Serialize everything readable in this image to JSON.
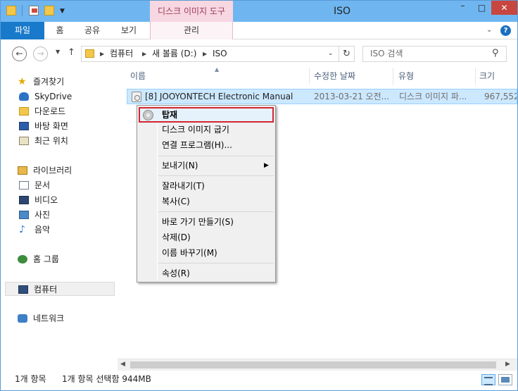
{
  "window": {
    "title": "ISO",
    "context_tab_title": "디스크 이미지 도구",
    "buttons": {
      "minimize": "–",
      "maximize": "□",
      "close": "✕"
    }
  },
  "ribbon": {
    "file_tab": "파일",
    "tabs": [
      "홈",
      "공유",
      "보기"
    ],
    "context_tab": "관리",
    "help": "?"
  },
  "address_bar": {
    "segments": [
      "컴퓨터",
      "새 볼륨 (D:)",
      "ISO"
    ],
    "search_placeholder": "ISO 검색"
  },
  "nav_pane": {
    "favorites": {
      "label": "즐겨찾기",
      "items": [
        "SkyDrive",
        "다운로드",
        "바탕 화면",
        "최근 위치"
      ]
    },
    "libraries": {
      "label": "라이브러리",
      "items": [
        "문서",
        "비디오",
        "사진",
        "음악"
      ]
    },
    "homegroup": "홈 그룹",
    "computer": "컴퓨터",
    "network": "네트워크"
  },
  "columns": {
    "name": "이름",
    "date": "수정한 날짜",
    "type": "유형",
    "size": "크기"
  },
  "files": [
    {
      "name": "[8] JOOYONTECH Electronic Manual",
      "date": "2013-03-21 오전...",
      "type": "디스크 이미지 파...",
      "size": "967,552"
    }
  ],
  "context_menu": {
    "highlighted": "탑재",
    "groups": [
      [
        "디스크 이미지 굽기",
        "연결 프로그램(H)..."
      ],
      [
        "보내기(N)"
      ],
      [
        "잘라내기(T)",
        "복사(C)"
      ],
      [
        "바로 가기 만들기(S)",
        "삭제(D)",
        "이름 바꾸기(M)"
      ],
      [
        "속성(R)"
      ]
    ]
  },
  "status": {
    "item_count": "1개 항목",
    "selection": "1개 항목 선택함 944MB"
  },
  "colors": {
    "titlebar": "#6fb6f0",
    "file_tab": "#1979ca",
    "context_tab": "#f7d7e1",
    "selection": "#cce8ff",
    "highlight_border": "#d42630"
  }
}
